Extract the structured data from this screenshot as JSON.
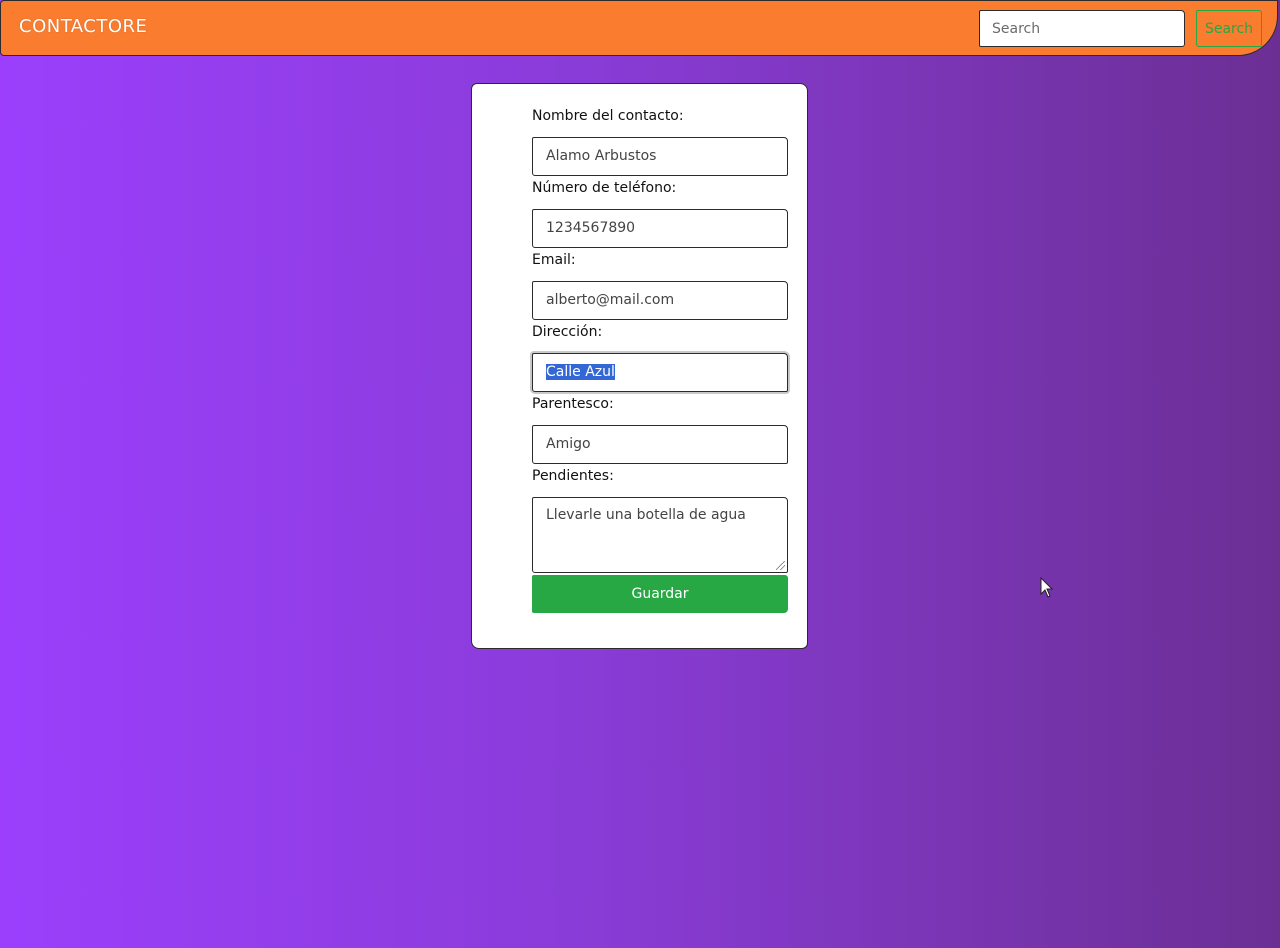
{
  "navbar": {
    "brand": "CONTACTORE",
    "search_placeholder": "Search",
    "search_button": "Search"
  },
  "form": {
    "fields": [
      {
        "label": "Nombre del contacto:",
        "value": "Alamo Arbustos"
      },
      {
        "label": "Número de teléfono:",
        "value": "1234567890"
      },
      {
        "label": "Email:",
        "value": "alberto@mail.com"
      },
      {
        "label": "Dirección:",
        "value": "Calle Azul"
      },
      {
        "label": "Parentesco:",
        "value": "Amigo"
      }
    ],
    "notes_label": "Pendientes:",
    "notes_value": "Llevarle una botella de agua",
    "save_button": "Guardar"
  },
  "colors": {
    "navbar": "#f97c2f",
    "accent_green": "#28a745",
    "background_start": "#9b3ffc",
    "background_end": "#6b2f94",
    "selection": "#3367d6"
  },
  "icons": [
    "mouse-cursor-icon"
  ]
}
